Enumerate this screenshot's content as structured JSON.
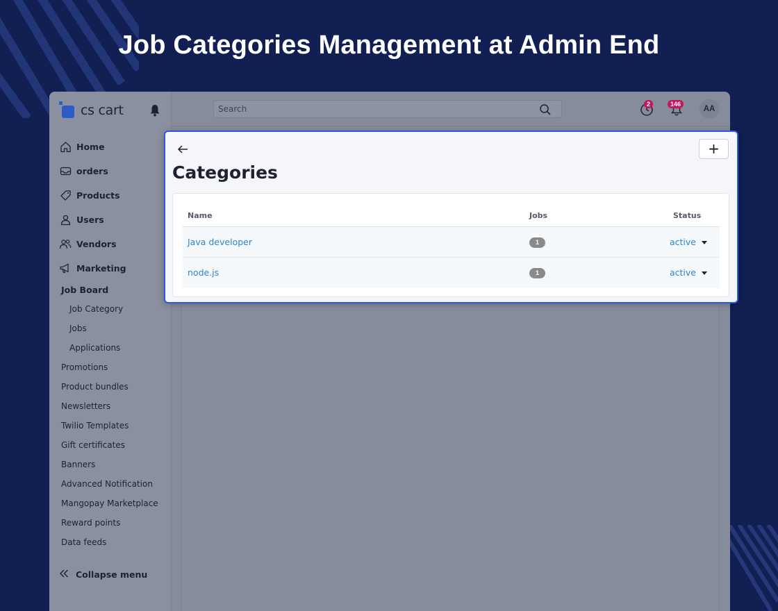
{
  "banner": {
    "title": "Job Categories Management at Admin End"
  },
  "app": {
    "logo_text": "cs cart",
    "colors": {
      "brand": "#2c5bc6",
      "link": "#2a85c9",
      "badge": "#c4185e",
      "highlight_border": "#2f58e8"
    }
  },
  "topbar": {
    "search_placeholder": "Search",
    "timer_badge": "2",
    "notifications_badge": "146",
    "avatar_initials": "AA",
    "icons": [
      "search-icon",
      "timer-icon",
      "bell-icon"
    ]
  },
  "sidebar": {
    "main_items": [
      {
        "label": "Home",
        "icon": "home-icon"
      },
      {
        "label": "orders",
        "icon": "inbox-icon"
      },
      {
        "label": "Products",
        "icon": "tag-icon"
      },
      {
        "label": "Users",
        "icon": "user-icon"
      },
      {
        "label": "Vendors",
        "icon": "users-icon"
      },
      {
        "label": "Marketing",
        "icon": "megaphone-icon"
      }
    ],
    "job_board": {
      "label": "Job Board",
      "items": [
        "Job Category",
        "Jobs",
        "Applications"
      ]
    },
    "marketing_items": [
      "Promotions",
      "Product bundles",
      "Newsletters",
      "Twilio Templates",
      "Gift certificates",
      "Banners",
      "Advanced Notification",
      "Mangopay Marketplace",
      "Reward points",
      "Data feeds"
    ],
    "collapse_label": "Collapse menu"
  },
  "panel": {
    "title": "Categories",
    "add_label": "+",
    "columns": {
      "name": "Name",
      "jobs": "Jobs",
      "status": "Status"
    },
    "rows": [
      {
        "name": "Java developer",
        "jobs": "1",
        "status": "active"
      },
      {
        "name": "node.js",
        "jobs": "1",
        "status": "active"
      }
    ]
  }
}
